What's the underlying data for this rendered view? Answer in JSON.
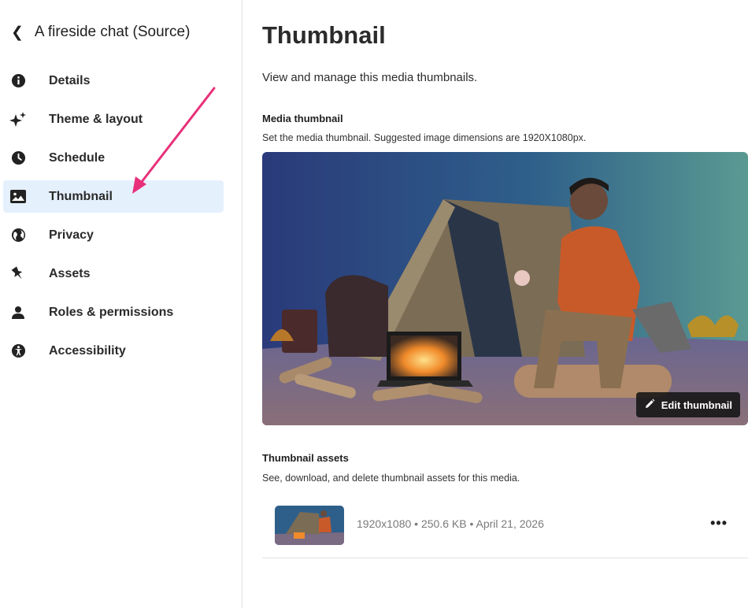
{
  "sidebar": {
    "back_label": "A fireside chat (Source)",
    "items": [
      {
        "label": "Details",
        "icon": "info-icon",
        "active": false
      },
      {
        "label": "Theme & layout",
        "icon": "sparkle-icon",
        "active": false
      },
      {
        "label": "Schedule",
        "icon": "clock-icon",
        "active": false
      },
      {
        "label": "Thumbnail",
        "icon": "image-icon",
        "active": true
      },
      {
        "label": "Privacy",
        "icon": "globe-icon",
        "active": false
      },
      {
        "label": "Assets",
        "icon": "pin-icon",
        "active": false
      },
      {
        "label": "Roles & permissions",
        "icon": "person-icon",
        "active": false
      },
      {
        "label": "Accessibility",
        "icon": "accessibility-icon",
        "active": false
      }
    ]
  },
  "main": {
    "title": "Thumbnail",
    "intro": "View and manage this media thumbnails.",
    "media_thumbnail": {
      "title": "Media thumbnail",
      "description": "Set the media thumbnail. Suggested image dimensions are 1920X1080px.",
      "edit_label": "Edit thumbnail"
    },
    "assets": {
      "title": "Thumbnail assets",
      "description": "See, download, and delete thumbnail assets for this media.",
      "rows": [
        {
          "meta": "1920x1080 • 250.6 KB • April 21, 2026",
          "more_label": "•••"
        }
      ]
    }
  },
  "colors": {
    "accent": "#e5f0fd",
    "arrow": "#e8307a"
  }
}
